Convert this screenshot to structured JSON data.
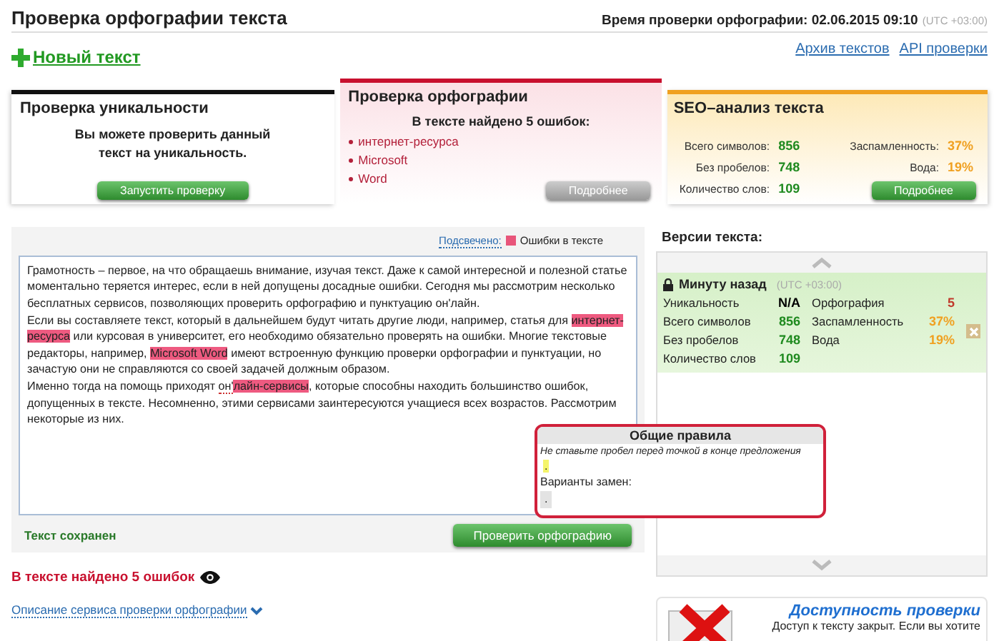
{
  "page_title": "Проверка орфографии текста",
  "check_time": {
    "label": "Время проверки орфографии: 02.06.2015 09:10",
    "timezone": "(UTC +03:00)"
  },
  "new_text_link": "Новый текст",
  "top_links": [
    "Архив текстов",
    "API проверки"
  ],
  "cards": [
    {
      "kind": "uniqueness",
      "title": "Проверка уникальности",
      "message": "Вы можете проверить данный текст на уникальность.",
      "button": {
        "label": "Запустить проверку",
        "disabled": false
      }
    },
    {
      "kind": "spelling",
      "title": "Проверка орфографии",
      "summary": "В тексте найдено 5 ошибок:",
      "errors": [
        "интернет-ресурса",
        "Microsoft",
        "Word"
      ],
      "button": {
        "label": "Подробнее",
        "disabled": true
      }
    },
    {
      "kind": "seo",
      "title": "SEO–анализ текста",
      "left_stats": [
        {
          "label": "Всего символов:",
          "value": "856",
          "color": "#1f8a1f"
        },
        {
          "label": "Без пробелов:",
          "value": "748",
          "color": "#1f8a1f"
        },
        {
          "label": "Количество слов:",
          "value": "109",
          "color": "#1f8a1f"
        }
      ],
      "right_stats": [
        {
          "label": "Заспамленность:",
          "value": "37%",
          "color": "#f0a020"
        },
        {
          "label": "Вода:",
          "value": "19%",
          "color": "#f0a020"
        }
      ],
      "button": {
        "label": "Подробнее",
        "disabled": false
      }
    }
  ],
  "editor": {
    "legend_label": "Подсвечено:",
    "legend_item": "Ошибки в тексте",
    "paragraphs": [
      [
        {
          "kind": "plain",
          "text": "Грамотность – первое, на что обращаешь внимание, изучая текст. Даже к самой интересной и полезной статье моментально теряется интерес, если в ней допущены досадные ошибки. Сегодня мы рассмотрим несколько бесплатных сервисов, позволяющих проверить орфографию и пунктуацию он'лайн."
        }
      ],
      [
        {
          "kind": "plain",
          "text": "Если вы составляете текст, который в дальнейшем будут читать другие люди, например, статья для "
        },
        {
          "kind": "error",
          "text": "интернет-ресурса"
        },
        {
          "kind": "plain",
          "text": " или курсовая в университет, его необходимо обязательно проверять на ошибки. Многие текстовые редакторы, например, "
        },
        {
          "kind": "error",
          "text": "Microsoft "
        },
        {
          "kind": "error",
          "text": "Word"
        },
        {
          "kind": "plain",
          "text": " имеют встроенную функцию проверки орфографии и пунктуации, но зачастую они не справляются со своей задачей должным образом."
        }
      ],
      [
        {
          "kind": "plain",
          "text": "Именно тогда на помощь приходят "
        },
        {
          "kind": "hint",
          "text": "он'"
        },
        {
          "kind": "error",
          "text": "лайн-сервисы"
        },
        {
          "kind": "plain",
          "text": ", которые способны находить большинство ошибок, допущенных в тексте. Несомненно, этими сервисами заинтересуются учащиеся всех возрастов. Рассмотрим некоторые из них."
        }
      ]
    ],
    "status": "Текст сохранен",
    "button": "Проверить орфографию"
  },
  "popup": {
    "title": "Общие правила",
    "message": "Не ставьте пробел перед точкой в конце предложения",
    "highlight": ".",
    "options_label": "Варианты замен:",
    "options": [
      "."
    ]
  },
  "result": "В тексте найдено 5 ошибок",
  "description_link": "Описание сервиса проверки орфографии",
  "versions": {
    "title": "Версии текста:",
    "items": [
      {
        "time": "Минуту назад",
        "timezone": "(UTC +03:00)",
        "locked": true,
        "left_stats": [
          {
            "label": "Уникальность",
            "value": "N/A",
            "color": "#000000"
          },
          {
            "label": "Всего символов",
            "value": "856",
            "color": "#1f8a1f"
          },
          {
            "label": "Без пробелов",
            "value": "748",
            "color": "#1f8a1f"
          },
          {
            "label": "Количество слов",
            "value": "109",
            "color": "#1f8a1f"
          }
        ],
        "right_stats": [
          {
            "label": "Орфография",
            "value": "5",
            "color": "#c0392b"
          },
          {
            "label": "Заспамленность",
            "value": "37%",
            "color": "#f0a020"
          },
          {
            "label": "Вода",
            "value": "19%",
            "color": "#f0a020"
          }
        ]
      }
    ]
  },
  "promo": {
    "title": "Доступность проверки",
    "text": "Доступ к тексту закрыт. Если вы хотите"
  }
}
